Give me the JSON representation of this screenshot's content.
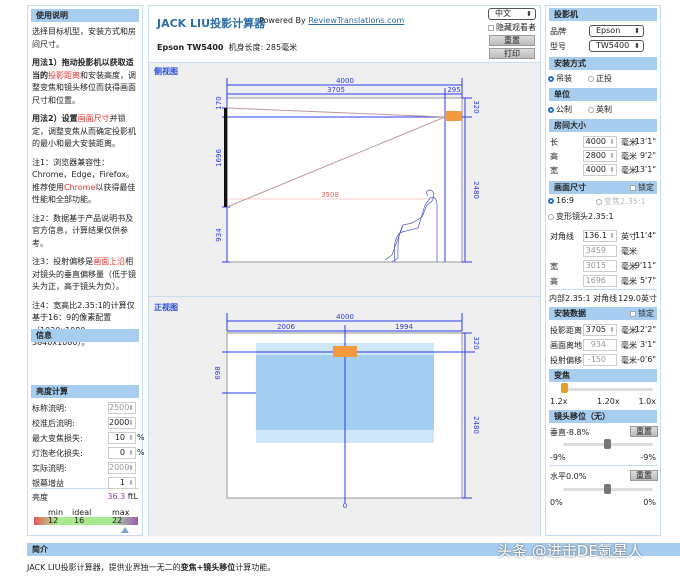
{
  "left": {
    "usage_title": "使用说明",
    "intro": "选择目标机型，安装方式和房间尺寸。",
    "m1_a": "用法1）拖动投影机以获取适当的",
    "m1_red": "投影距离",
    "m1_b": "和安装高度，调整变焦和镜头移位而获得画面尺寸和位置。",
    "m2_a": "用法2）设置",
    "m2_red": "画面尺寸",
    "m2_b": "并锁定，调整变焦从而确定投影机的最小和最大安装距离。",
    "n1_a": "注1：浏览器兼容性：Chrome，Edge，Firefox。推荐使用",
    "n1_red": "Chrome",
    "n1_b": "以获得最佳性能和全部功能。",
    "n2": "注2：数据基于产品说明书及官方信息，计算结果仅供参考。",
    "n3_a": "注3：投射偏移是",
    "n3_red": "画面上沿",
    "n3_b": "相对镜头的垂直偏移量（低于镜头为正，高于镜头为负）。",
    "n4": "注4：宽高比2.35:1的计算仅基于16：9的像素配置（1920x1080，3840x1080）。",
    "info_title": "信息",
    "bright_title": "亮度计算",
    "rows": [
      {
        "label": "标称流明:",
        "value": "2500",
        "unit": ""
      },
      {
        "label": "校准后流明:",
        "value": "2000",
        "unit": ""
      },
      {
        "label": "最大变焦损失:",
        "value": "10",
        "unit": "%"
      },
      {
        "label": "灯泡老化损失:",
        "value": "0",
        "unit": "%"
      },
      {
        "label": "实际流明:",
        "value": "2000",
        "unit": ""
      },
      {
        "label": "银幕增益",
        "value": "1",
        "unit": ""
      }
    ],
    "brightness_label": "亮度",
    "brightness_value": "36.3",
    "brightness_unit": "ftL",
    "scale": {
      "min_label": "min",
      "ideal_label": "ideal",
      "max_label": "max",
      "min": "12",
      "ideal": "16",
      "max": "22"
    }
  },
  "header": {
    "title": "JACK LIU投影计算器",
    "powered": "Powered By",
    "link": "ReviewTranslations.com",
    "model": "Epson TW5400",
    "body_len": "机身长度: 285毫米",
    "lang": "中文",
    "hide_viewer": "隐藏观看者",
    "reset": "重置",
    "print": "打印"
  },
  "side": {
    "title": "侧视图",
    "w_total": "4000",
    "w_dist": "3705",
    "w_body": "295",
    "h_top": "170",
    "h_screen": "1696",
    "h_bottom": "934",
    "r_top": "320",
    "r_bottom": "2480",
    "distance": "3508"
  },
  "front": {
    "title": "正视图",
    "w_total": "4000",
    "w_left": "2006",
    "w_right": "1994",
    "h_left": "698",
    "r_top": "320",
    "r_bottom": "2480",
    "center": "0"
  },
  "right": {
    "projector_title": "投影机",
    "brand_label": "品牌",
    "brand": "Epson",
    "model_label": "型号",
    "model": "TW5400",
    "mount_title": "安装方式",
    "mount_ceiling": "吊装",
    "mount_front": "正投",
    "unit_title": "单位",
    "unit_metric": "公制",
    "unit_imperial": "英制",
    "room_title": "房间大小",
    "room": [
      {
        "label": "长",
        "value": "4000",
        "unit": "毫米",
        "imp": "13'1\""
      },
      {
        "label": "高",
        "value": "2800",
        "unit": "毫米",
        "imp": "9'2\""
      },
      {
        "label": "宽",
        "value": "4000",
        "unit": "毫米",
        "imp": "13'1\""
      }
    ],
    "screen_title": "画面尺寸",
    "lock": "锁定",
    "ratio169": "16:9",
    "ratio235": "变焦2.35:1",
    "anamorphic": "变形镜头2.35:1",
    "screen": [
      {
        "label": "对角线",
        "value": "136.1",
        "unit": "英寸",
        "imp": "11'4\""
      },
      {
        "label": "",
        "value": "3459",
        "unit": "毫米",
        "imp": ""
      },
      {
        "label": "宽",
        "value": "3015",
        "unit": "毫米",
        "imp": "9'11\""
      },
      {
        "label": "高",
        "value": "1696",
        "unit": "毫米",
        "imp": "5'7\""
      }
    ],
    "inner_label": "内部2.35:1 对角线",
    "inner_value": "129.0英寸",
    "install_title": "安装数据",
    "install": [
      {
        "label": "投影距离",
        "value": "3705",
        "unit": "毫米",
        "imp": "12'2\""
      },
      {
        "label": "画面离地",
        "value": "934",
        "unit": "毫米",
        "imp": "3'1\""
      },
      {
        "label": "投射偏移",
        "value": "-150",
        "unit": "毫米",
        "imp": "-0'6\""
      }
    ],
    "zoom_title": "变焦",
    "zoom_min": "1.2x",
    "zoom_cur": "1.20x",
    "zoom_max": "1.0x",
    "zoom_fraction": 0,
    "shift_title": "镜头移位（无）",
    "vert": "垂直-8.8%",
    "vert_min": "-9%",
    "vert_max": "-9%",
    "horiz": "水平0.0%",
    "horiz_min": "0%",
    "horiz_max": "0%",
    "reset": "重置"
  },
  "footer": {
    "title": "简介",
    "text_a": "JACK LIU投影计算器，提供业界独一无二的",
    "text_b": "变焦+镜头移位",
    "text_c": "计算功能。",
    "watermark": "头条 @进击DE氪星人"
  }
}
